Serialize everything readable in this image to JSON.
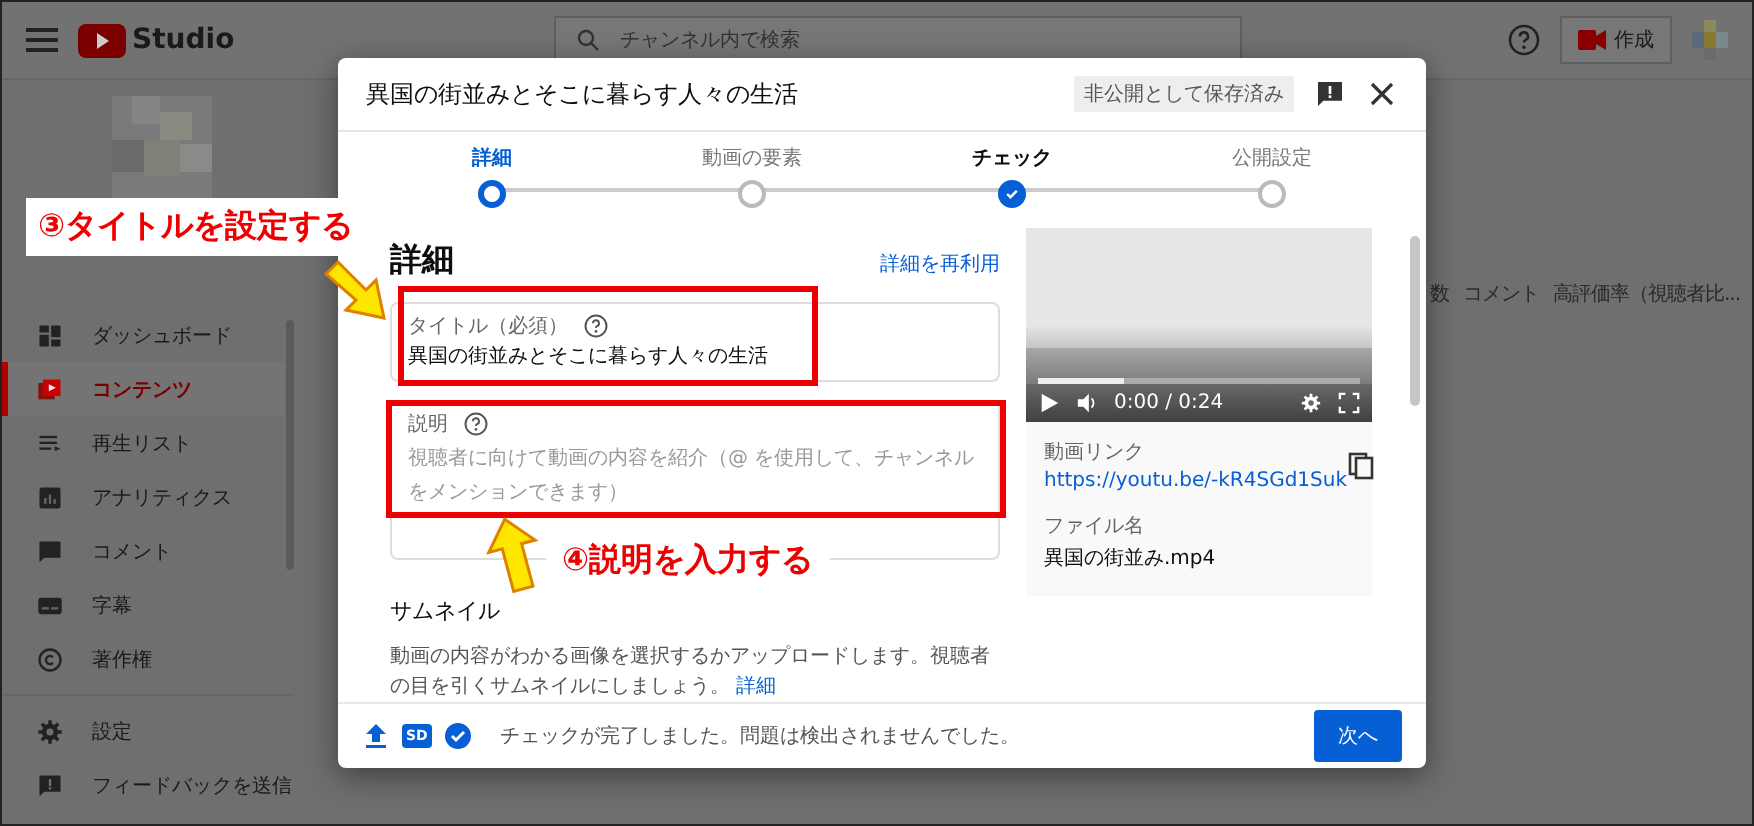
{
  "topbar": {
    "logo": "Studio",
    "search": {
      "placeholder": "チャンネル内で検索"
    },
    "create_label": "作成"
  },
  "sidebar": {
    "items": [
      {
        "label": "ダッシュボード",
        "selected": false
      },
      {
        "label": "コンテンツ",
        "selected": true
      },
      {
        "label": "再生リスト",
        "selected": false
      },
      {
        "label": "アナリティクス",
        "selected": false
      },
      {
        "label": "コメント",
        "selected": false
      },
      {
        "label": "字幕",
        "selected": false
      },
      {
        "label": "著作権",
        "selected": false
      }
    ],
    "footer_items": [
      {
        "label": "設定"
      },
      {
        "label": "フィードバックを送信"
      }
    ]
  },
  "table": {
    "columns": [
      "数",
      "コメント",
      "高評価率（視聴者比..."
    ]
  },
  "dialog": {
    "title": "異国の街並みとそこに暮らす人々の生活",
    "status_badge": "非公開として保存済み",
    "steps": [
      {
        "label": "詳細",
        "selected": true,
        "done": false
      },
      {
        "label": "動画の要素",
        "selected": false,
        "done": false
      },
      {
        "label": "チェック",
        "selected": false,
        "done": true
      },
      {
        "label": "公開設定",
        "selected": false,
        "done": false
      }
    ],
    "heading": "詳細",
    "reuse_link": "詳細を再利用",
    "title_field": {
      "label": "タイトル（必須）",
      "value": "異国の街並みとそこに暮らす人々の生活"
    },
    "description_field": {
      "label": "説明",
      "placeholder": "視聴者に向けて動画の内容を紹介（@ を使用して、チャンネルをメンションできます）"
    },
    "thumbnail": {
      "heading": "サムネイル",
      "text": "動画の内容がわかる画像を選択するかアップロードします。視聴者の目を引くサムネイルにしましょう。",
      "link": "詳細"
    },
    "video": {
      "time": "0:00 / 0:24",
      "progress": {
        "level": 0.27
      },
      "link_label": "動画リンク",
      "link": "https://youtu.be/-kR4SGd1Suk",
      "file_label": "ファイル名",
      "file_name": "異国の街並み.mp4"
    },
    "footer": {
      "sd_badge": "SD",
      "status": "チェックが完了しました。問題は検出されませんでした。",
      "next_button": "次へ"
    }
  },
  "annotations": [
    {
      "text": "③タイトルを設定する"
    },
    {
      "text": "④説明を入力する"
    }
  ]
}
